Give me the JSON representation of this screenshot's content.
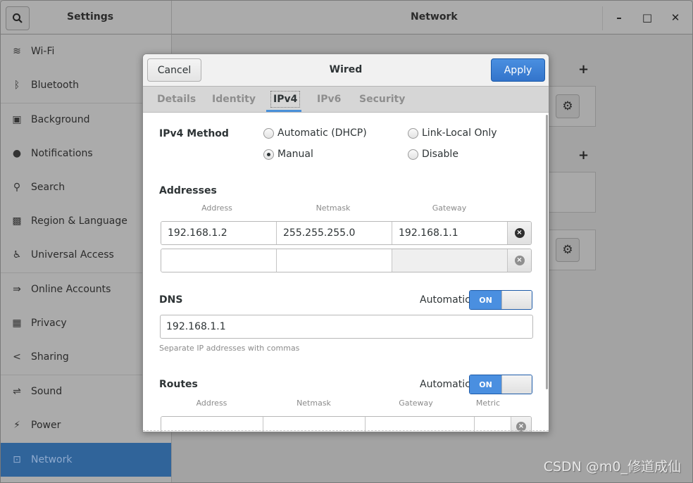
{
  "window": {
    "sidebar_title": "Settings",
    "panel_title": "Network",
    "controls": {
      "minimize": "–",
      "maximize": "□",
      "close": "✕"
    }
  },
  "sidebar": {
    "items": [
      {
        "label": "Wi-Fi",
        "icon": "wifi-icon",
        "glyph": "≋"
      },
      {
        "label": "Bluetooth",
        "icon": "bluetooth-icon",
        "glyph": "ᛒ"
      },
      {
        "label": "Background",
        "icon": "background-icon",
        "glyph": "▣"
      },
      {
        "label": "Notifications",
        "icon": "notifications-icon",
        "glyph": "●"
      },
      {
        "label": "Search",
        "icon": "search-icon",
        "glyph": "⚲"
      },
      {
        "label": "Region & Language",
        "icon": "region-language-icon",
        "glyph": "▩"
      },
      {
        "label": "Universal Access",
        "icon": "universal-access-icon",
        "glyph": "♿"
      },
      {
        "label": "Online Accounts",
        "icon": "online-accounts-icon",
        "glyph": "⇛"
      },
      {
        "label": "Privacy",
        "icon": "privacy-icon",
        "glyph": "▦"
      },
      {
        "label": "Sharing",
        "icon": "sharing-icon",
        "glyph": "<"
      },
      {
        "label": "Sound",
        "icon": "sound-icon",
        "glyph": "⇌"
      },
      {
        "label": "Power",
        "icon": "power-icon",
        "glyph": "⚡"
      },
      {
        "label": "Network",
        "icon": "network-icon",
        "glyph": "⊡"
      }
    ],
    "active": "Network"
  },
  "background_panel": {
    "add_glyph": "+",
    "gear_glyph": "⚙"
  },
  "dialog": {
    "title": "Wired",
    "cancel_label": "Cancel",
    "apply_label": "Apply",
    "tabs": [
      "Details",
      "Identity",
      "IPv4",
      "IPv6",
      "Security"
    ],
    "active_tab": "IPv4",
    "ipv4_method": {
      "label": "IPv4 Method",
      "options": [
        "Automatic (DHCP)",
        "Link-Local Only",
        "Manual",
        "Disable"
      ],
      "selected": "Manual"
    },
    "addresses": {
      "label": "Addresses",
      "headers": [
        "Address",
        "Netmask",
        "Gateway"
      ],
      "rows": [
        {
          "address": "192.168.1.2",
          "netmask": "255.255.255.0",
          "gateway": "192.168.1.1"
        },
        {
          "address": "",
          "netmask": "",
          "gateway": ""
        }
      ]
    },
    "dns": {
      "label": "DNS",
      "automatic_label": "Automatic",
      "toggle": "ON",
      "value": "192.168.1.1",
      "hint": "Separate IP addresses with commas"
    },
    "routes": {
      "label": "Routes",
      "automatic_label": "Automatic",
      "toggle": "ON",
      "headers": [
        "Address",
        "Netmask",
        "Gateway",
        "Metric"
      ]
    },
    "delete_glyph": "×"
  },
  "watermark": "CSDN @m0_修道成仙"
}
